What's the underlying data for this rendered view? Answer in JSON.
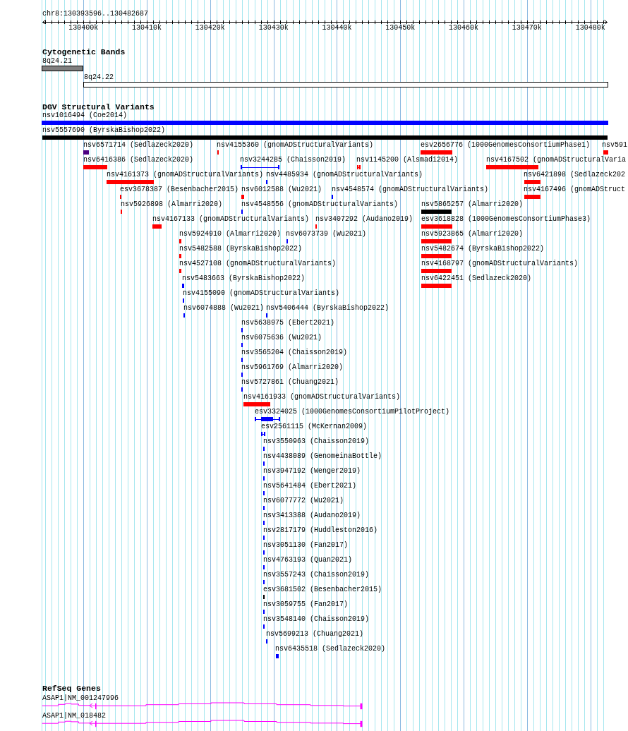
{
  "ruler": {
    "location": "chr8:130393596..130482687",
    "ticks": [
      "130400k",
      "130410k",
      "130420k",
      "130430k",
      "130440k",
      "130450k",
      "130460k",
      "130470k",
      "130480k"
    ]
  },
  "tracks": [
    {
      "kind": "bands",
      "title": "Cytogenetic Bands",
      "features": [
        {
          "label": "8q24.21",
          "color": "#808080"
        },
        {
          "label": "8q24.22",
          "color": "#ffffff"
        }
      ]
    },
    {
      "kind": "variants",
      "title": "DGV Structural Variants",
      "features": [
        {
          "label": "nsv1016494 (Coe2014)",
          "color": "#0000ff"
        },
        {
          "label": "nsv5557690 (ByrskaBishop2022)",
          "color": "#000000"
        },
        {
          "label": "nsv6571714 (Sedlazeck2020)",
          "color": "#4b0082"
        },
        {
          "label": "nsv4155360 (gnomADStructuralVariants)",
          "color": "#ff0000"
        },
        {
          "label": "esv2656776 (1000GenomesConsortiumPhase1)",
          "color": "#ff0000"
        },
        {
          "label": "nsv591",
          "color": "#ff0000"
        },
        {
          "label": "nsv6416386 (Sedlazeck2020)",
          "color": "#ff0000"
        },
        {
          "label": "nsv3244285 (Chaisson2019)",
          "color": "#0000ff"
        },
        {
          "label": "nsv1145200 (Alsmadi2014)",
          "color": "#ff0000"
        },
        {
          "label": "nsv4167502 (gnomADStructuralVaria",
          "color": "#ff0000"
        },
        {
          "label": "nsv4161373 (gnomADStructuralVariants)",
          "color": "#ff0000"
        },
        {
          "label": "nsv4485934 (gnomADStructuralVariants)",
          "color": "#0000ff"
        },
        {
          "label": "nsv6421898 (Sedlazeck202",
          "color": "#ff0000"
        },
        {
          "label": "esv3678387 (Besenbacher2015)",
          "color": "#ff0000"
        },
        {
          "label": "nsv6012588 (Wu2021)",
          "color": "#ff0000"
        },
        {
          "label": "nsv4548574 (gnomADStructuralVariants)",
          "color": "#0000ff"
        },
        {
          "label": "nsv4167496 (gnomADStruct",
          "color": "#ff0000"
        },
        {
          "label": "nsv5926898 (Almarri2020)",
          "color": "#ff0000"
        },
        {
          "label": "nsv4548556 (gnomADStructuralVariants)",
          "color": "#0000ff"
        },
        {
          "label": "nsv5865257 (Almarri2020)",
          "color": "#000000"
        },
        {
          "label": "nsv4167133 (gnomADStructuralVariants)",
          "color": "#ff0000"
        },
        {
          "label": "nsv3407292 (Audano2019)",
          "color": "#ff0000"
        },
        {
          "label": "esv3618828 (1000GenomesConsortiumPhase3)",
          "color": "#ff0000"
        },
        {
          "label": "nsv5924910 (Almarri2020)",
          "color": "#ff0000"
        },
        {
          "label": "nsv6073739 (Wu2021)",
          "color": "#0000ff"
        },
        {
          "label": "nsv5923865 (Almarri2020)",
          "color": "#ff0000"
        },
        {
          "label": "nsv5482588 (ByrskaBishop2022)",
          "color": "#ff0000"
        },
        {
          "label": "nsv5482674 (ByrskaBishop2022)",
          "color": "#ff0000"
        },
        {
          "label": "nsv4527108 (gnomADStructuralVariants)",
          "color": "#ff0000"
        },
        {
          "label": "nsv4168797 (gnomADStructuralVariants)",
          "color": "#ff0000"
        },
        {
          "label": "nsv5483663 (ByrskaBishop2022)",
          "color": "#0000ff"
        },
        {
          "label": "nsv6422451 (Sedlazeck2020)",
          "color": "#ff0000"
        },
        {
          "label": "nsv4155090 (gnomADStructuralVariants)",
          "color": "#0000ff"
        },
        {
          "label": "nsv6074888 (Wu2021)",
          "color": "#0000ff"
        },
        {
          "label": "nsv5406444 (ByrskaBishop2022)",
          "color": "#0000ff"
        },
        {
          "label": "nsv5638975 (Ebert2021)",
          "color": "#0000ff"
        },
        {
          "label": "nsv6075636 (Wu2021)",
          "color": "#0000ff"
        },
        {
          "label": "nsv3565204 (Chaisson2019)",
          "color": "#0000ff"
        },
        {
          "label": "nsv5961769 (Almarri2020)",
          "color": "#0000ff"
        },
        {
          "label": "nsv5727861 (Chuang2021)",
          "color": "#0000ff"
        },
        {
          "label": "nsv4161933 (gnomADStructuralVariants)",
          "color": "#ff0000"
        },
        {
          "label": "esv3324025 (1000GenomesConsortiumPilotProject)",
          "color": "#0000ff"
        },
        {
          "label": "esv2561115 (McKernan2009)",
          "color": "#0000ff"
        },
        {
          "label": "nsv3550963 (Chaisson2019)",
          "color": "#0000ff"
        },
        {
          "label": "nsv4438089 (GenomeinaBottle)",
          "color": "#0000ff"
        },
        {
          "label": "nsv3947192 (Wenger2019)",
          "color": "#0000ff"
        },
        {
          "label": "nsv5641484 (Ebert2021)",
          "color": "#0000ff"
        },
        {
          "label": "nsv6077772 (Wu2021)",
          "color": "#0000ff"
        },
        {
          "label": "nsv3413388 (Audano2019)",
          "color": "#0000ff"
        },
        {
          "label": "nsv2817179 (Huddleston2016)",
          "color": "#0000ff"
        },
        {
          "label": "nsv3051130 (Fan2017)",
          "color": "#0000ff"
        },
        {
          "label": "nsv4763193 (Quan2021)",
          "color": "#0000ff"
        },
        {
          "label": "nsv3557243 (Chaisson2019)",
          "color": "#0000ff"
        },
        {
          "label": "esv3681502 (Besenbacher2015)",
          "color": "#000000"
        },
        {
          "label": "nsv3059755 (Fan2017)",
          "color": "#0000ff"
        },
        {
          "label": "nsv3548140 (Chaisson2019)",
          "color": "#0000ff"
        },
        {
          "label": "nsv5699213 (Chuang2021)",
          "color": "#0000ff"
        },
        {
          "label": "nsv6435518 (Sedlazeck2020)",
          "color": "#0000ff"
        }
      ]
    },
    {
      "kind": "genes",
      "title": "RefSeq Genes",
      "features": [
        {
          "label": "ASAP1|NM_001247996"
        },
        {
          "label": "ASAP1|NM_018482"
        }
      ]
    }
  ]
}
